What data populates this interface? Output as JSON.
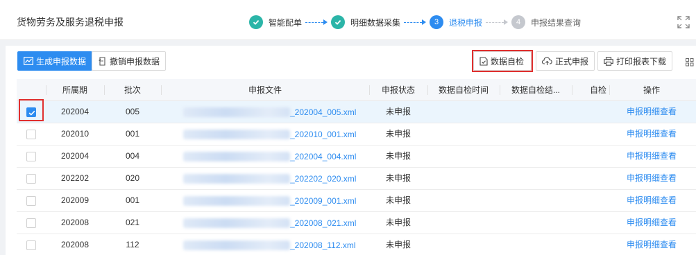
{
  "header": {
    "title": "货物劳务及服务退税申报",
    "steps": [
      {
        "num": "1",
        "label": "智能配单",
        "state": "done"
      },
      {
        "num": "2",
        "label": "明细数据采集",
        "state": "done"
      },
      {
        "num": "3",
        "label": "退税申报",
        "state": "active"
      },
      {
        "num": "4",
        "label": "申报结果查询",
        "state": "todo"
      }
    ]
  },
  "toolbar": {
    "generate": "生成申报数据",
    "revoke": "撤销申报数据",
    "selfcheck": "数据自检",
    "formal": "正式申报",
    "print": "打印报表下载"
  },
  "table": {
    "columns": [
      "所属期",
      "批次",
      "申报文件",
      "申报状态",
      "数据自检时间",
      "数据自检结...",
      "自检",
      "操作"
    ],
    "rows": [
      {
        "period": "202004",
        "batch": "005",
        "file": "_202004_005.xml",
        "status": "未申报",
        "action": "申报明细查看",
        "checked": true
      },
      {
        "period": "202010",
        "batch": "001",
        "file": "_202010_001.xml",
        "status": "未申报",
        "action": "申报明细查看",
        "checked": false
      },
      {
        "period": "202004",
        "batch": "004",
        "file": "_202004_004.xml",
        "status": "未申报",
        "action": "申报明细查看",
        "checked": false
      },
      {
        "period": "202202",
        "batch": "020",
        "file": "_202202_020.xml",
        "status": "未申报",
        "action": "申报明细查看",
        "checked": false
      },
      {
        "period": "202009",
        "batch": "001",
        "file": "_202009_001.xml",
        "status": "未申报",
        "action": "申报明细查看",
        "checked": false
      },
      {
        "period": "202008",
        "batch": "021",
        "file": "_202008_021.xml",
        "status": "未申报",
        "action": "申报明细查看",
        "checked": false
      },
      {
        "period": "202008",
        "batch": "112",
        "file": "_202008_112.xml",
        "status": "未申报",
        "action": "申报明细查看",
        "checked": false
      }
    ]
  },
  "colors": {
    "primary": "#2d8cf0",
    "done": "#2bb5a8",
    "highlight": "#e0302f"
  }
}
